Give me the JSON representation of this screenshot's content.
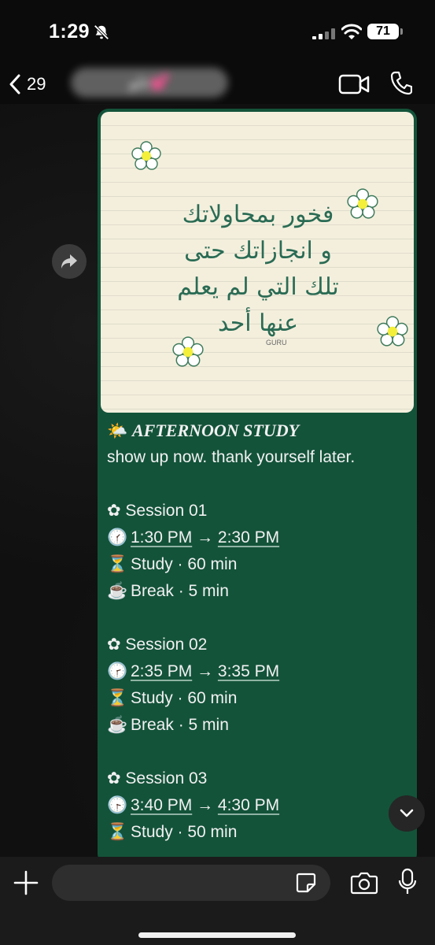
{
  "status_bar": {
    "time": "1:29",
    "battery": "71"
  },
  "header": {
    "back_count": "29",
    "contact_name": "غلو💕"
  },
  "image_card": {
    "text_lines": [
      "فخور بمحاولاتك",
      "و انجازاتك حتى",
      "تلك التي لم يعلم",
      "عنها أحد"
    ],
    "signature": "GURU"
  },
  "message": {
    "title_emoji": "🌤️",
    "title": "AFTERNOON STUDY",
    "subtitle": "show up now. thank yourself later.",
    "sessions": [
      {
        "label": "✿ Session 01",
        "clock": "🕜",
        "start": "1:30 PM",
        "end": "2:30 PM",
        "study": "Study · 60 min",
        "brk": "Break · 5 min"
      },
      {
        "label": "✿ Session 02",
        "clock": "🕝",
        "start": "2:35 PM",
        "end": "3:35 PM",
        "study": "Study · 60 min",
        "brk": "Break · 5 min"
      },
      {
        "label": "✿ Session 03",
        "clock": "🕞",
        "start": "3:40 PM",
        "end": "4:30 PM",
        "study": "Study · 50 min"
      }
    ],
    "arrow": "→",
    "hourglass": "⏳",
    "coffee": "☕"
  },
  "colors": {
    "bubble": "#13533a",
    "accent_text": "#2a6b54"
  }
}
